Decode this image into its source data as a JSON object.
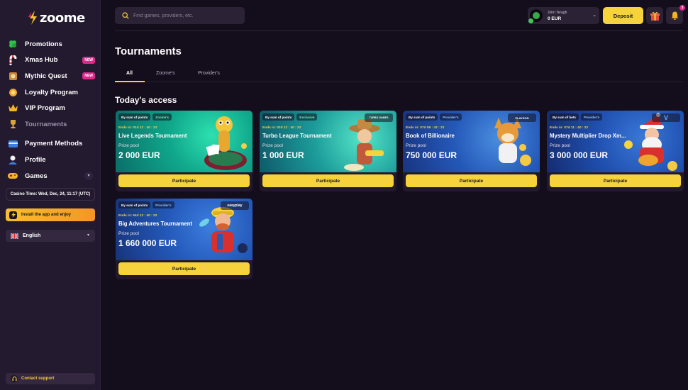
{
  "brand": {
    "name": "zoome"
  },
  "sidebar": {
    "items": [
      {
        "label": "Promotions",
        "icon": "clover-icon",
        "badge": ""
      },
      {
        "label": "Xmas Hub",
        "icon": "candy-cane-icon",
        "badge": "NEW"
      },
      {
        "label": "Mythic Quest",
        "icon": "quest-icon",
        "badge": "NEW"
      },
      {
        "label": "Loyalty Program",
        "icon": "loyalty-icon",
        "badge": ""
      },
      {
        "label": "VIP Program",
        "icon": "crown-icon",
        "badge": ""
      },
      {
        "label": "Tournaments",
        "icon": "trophy-icon",
        "badge": ""
      }
    ],
    "items2": [
      {
        "label": "Payment Methods",
        "icon": "card-icon"
      },
      {
        "label": "Profile",
        "icon": "profile-icon"
      },
      {
        "label": "Games",
        "icon": "gamepad-icon"
      }
    ],
    "casino_time": "Casino Time: Wed, Dec, 24, 11:17 (UTC)",
    "install_label": "Install the app and enjoy",
    "language": "English",
    "support_label": "Contact support"
  },
  "header": {
    "search_placeholder": "Find games, providers, etc.",
    "user_name": "John Teragh",
    "balance": "0 EUR",
    "deposit_label": "Deposit",
    "notif_count": "3"
  },
  "page": {
    "title": "Tournaments",
    "tabs": [
      "All",
      "Zoome's",
      "Provider's"
    ],
    "section_title": "Today's access"
  },
  "cards": [
    {
      "tag1": "By sum of points",
      "tag2": "Zoome's",
      "provider": "",
      "ends": "Ends in: 01d 12 : 40 : 22",
      "title": "Live Legends Tournament",
      "prize_label": "Prize pool",
      "prize": "2 000 EUR",
      "button": "Participate"
    },
    {
      "tag1": "By sum of points",
      "tag2": "Exclusive",
      "provider": "TURBO GAMES",
      "ends": "Ends in: 02d 12 : 40 : 22",
      "title": "Turbo League Tournament",
      "prize_label": "Prize pool",
      "prize": "1 000 EUR",
      "button": "Participate"
    },
    {
      "tag1": "By sum of points",
      "tag2": "Provider's",
      "provider": "PLAYSON",
      "ends": "Ends in: 07d 09 : 42 : 22",
      "title": "Book of Billionaire",
      "prize_label": "Prize pool",
      "prize": "750 000 EUR",
      "button": "Participate"
    },
    {
      "tag1": "By sum of bets",
      "tag2": "Provider's",
      "provider": "V",
      "ends": "Ends in: 07d 11 : 40 : 22",
      "title": "Mystery Multiplier Drop Xm...",
      "prize_label": "Prize pool",
      "prize": "3 000 000 EUR",
      "button": "Participate"
    },
    {
      "tag1": "By sum of points",
      "tag2": "Provider's",
      "provider": "easyplay",
      "ends": "Ends in: 64d 12 : 40 : 22",
      "title": "Big Adventures Tournament",
      "prize_label": "Prize pool",
      "prize": "1 660 000 EUR",
      "button": "Participate"
    }
  ],
  "colors": {
    "accent": "#f6d33c",
    "badge": "#e0288a",
    "bg": "#140d1c",
    "sidebar": "#241a30"
  }
}
